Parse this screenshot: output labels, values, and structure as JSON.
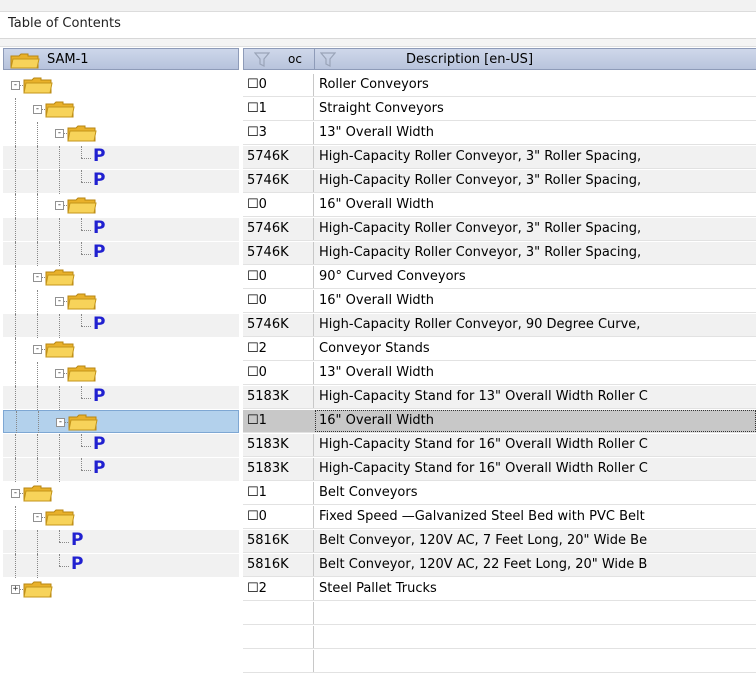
{
  "panel": {
    "title": "Table of Contents"
  },
  "tree_header": {
    "root_label": "SAM-1"
  },
  "grid_header": {
    "col1": "oc",
    "col2": "Description [en-US]"
  },
  "rows": [
    {
      "c1": "☐0",
      "c2": "Roller Conveyors"
    },
    {
      "c1": "☐1",
      "c2": "Straight Conveyors"
    },
    {
      "c1": "☐3",
      "c2": "13\" Overall Width"
    },
    {
      "c1": "5746K",
      "c2": "High-Capacity Roller Conveyor, 3\" Roller Spacing,"
    },
    {
      "c1": "5746K",
      "c2": "High-Capacity Roller Conveyor, 3\" Roller Spacing,"
    },
    {
      "c1": "☐0",
      "c2": "16\" Overall Width"
    },
    {
      "c1": "5746K",
      "c2": "High-Capacity Roller Conveyor, 3\" Roller Spacing,"
    },
    {
      "c1": "5746K",
      "c2": "High-Capacity Roller Conveyor, 3\" Roller Spacing,"
    },
    {
      "c1": "☐0",
      "c2": "90° Curved Conveyors"
    },
    {
      "c1": "☐0",
      "c2": "16\" Overall Width"
    },
    {
      "c1": "5746K",
      "c2": "High-Capacity Roller Conveyor, 90 Degree Curve,"
    },
    {
      "c1": "☐2",
      "c2": "Conveyor Stands"
    },
    {
      "c1": "☐0",
      "c2": "13\" Overall Width"
    },
    {
      "c1": "5183K",
      "c2": "High-Capacity Stand for 13\" Overall Width Roller C"
    },
    {
      "c1": "☐1",
      "c2": "16\" Overall Width"
    },
    {
      "c1": "5183K",
      "c2": "High-Capacity Stand for 16\" Overall Width Roller C"
    },
    {
      "c1": "5183K",
      "c2": "High-Capacity Stand for 16\" Overall Width Roller C"
    },
    {
      "c1": "☐1",
      "c2": "Belt Conveyors"
    },
    {
      "c1": "☐0",
      "c2": "Fixed Speed —Galvanized Steel Bed with PVC Belt"
    },
    {
      "c1": "5816K",
      "c2": "Belt Conveyor, 120V AC, 7 Feet Long, 20\" Wide Be"
    },
    {
      "c1": "5816K",
      "c2": "Belt Conveyor, 120V AC, 22 Feet Long, 20\" Wide B"
    },
    {
      "c1": "☐2",
      "c2": "Steel Pallet Trucks"
    }
  ],
  "tree": [
    {
      "level": 0,
      "type": "folder",
      "expander": "-"
    },
    {
      "level": 1,
      "type": "folder",
      "expander": "-"
    },
    {
      "level": 2,
      "type": "folder",
      "expander": "-"
    },
    {
      "level": 3,
      "type": "product",
      "glyph": "P"
    },
    {
      "level": 3,
      "type": "product",
      "glyph": "P"
    },
    {
      "level": 2,
      "type": "folder",
      "expander": "-"
    },
    {
      "level": 3,
      "type": "product",
      "glyph": "P"
    },
    {
      "level": 3,
      "type": "product",
      "glyph": "P"
    },
    {
      "level": 1,
      "type": "folder",
      "expander": "-"
    },
    {
      "level": 2,
      "type": "folder",
      "expander": "-"
    },
    {
      "level": 3,
      "type": "product",
      "glyph": "P"
    },
    {
      "level": 1,
      "type": "folder",
      "expander": "-"
    },
    {
      "level": 2,
      "type": "folder",
      "expander": "-"
    },
    {
      "level": 3,
      "type": "product",
      "glyph": "P"
    },
    {
      "level": 2,
      "type": "folder",
      "expander": "-"
    },
    {
      "level": 3,
      "type": "product",
      "glyph": "P"
    },
    {
      "level": 3,
      "type": "product",
      "glyph": "P"
    },
    {
      "level": 0,
      "type": "folder",
      "expander": "-"
    },
    {
      "level": 1,
      "type": "folder",
      "expander": "-"
    },
    {
      "level": 2,
      "type": "product",
      "glyph": "P"
    },
    {
      "level": 2,
      "type": "product",
      "glyph": "P"
    },
    {
      "level": 0,
      "type": "folder",
      "expander": "+"
    }
  ],
  "selected_row": 14,
  "colors": {
    "accent": "#2020d0",
    "selection_tree": "#b3d1ec",
    "selection_grid": "#c8c8c8",
    "folder": "#f2c23a"
  }
}
